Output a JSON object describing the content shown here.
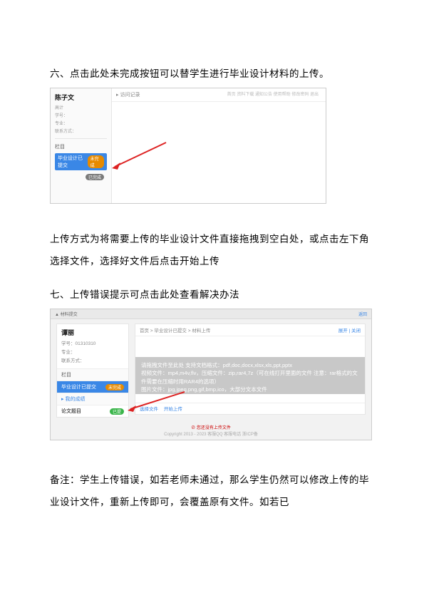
{
  "headings": {
    "six": "六、点击此处未完成按钮可以替学生进行毕业设计材料的上传。",
    "upload_note": "上传方式为将需要上传的毕业设计文件直接拖拽到空白处，或点击左下角选择文件，选择好文件后点击开始上传",
    "seven": "七、上传错误提示可点击此处查看解决办法",
    "remark": "备注：学生上传错误，如若老师未通过，那么学生仍然可以修改上传的毕业设计文件，重新上传即可，会覆盖原有文件。如若已"
  },
  "shot1": {
    "student_name": "陈子文",
    "sub1": "高计",
    "sub2": "学号：",
    "sub3": "专业：",
    "sub4": "联系方式：",
    "sec_label": "栏目",
    "row_active": "毕业设计已提交",
    "pill_active": "未完成",
    "row_plain_pill": "已完成",
    "crumb": "▸ 访问记录",
    "topbar": "首页  资料下载  通知公告  使用帮助  修改密码  退出"
  },
  "shot2": {
    "topnav_left": "▲ 材料提交",
    "topnav_right_ret": "返回",
    "student_name": "谭丽",
    "sub1": "学号：01310310",
    "sub2": "专业：",
    "sub3": "联系方式：",
    "cap1": "栏目",
    "row_blue": "毕业设计已提交",
    "row_blue_pill": "未完成",
    "cap_link": "▸ 我的成绩",
    "row_g": "论文题目",
    "row_g_pill": "已提",
    "ptop_left": "首页 > 毕业设计已提交 > 材料上传",
    "ptop_right": "展开 | 关闭",
    "drop_l1": "请拖拽文件至此处 支持文档格式：pdf,doc,docx,xlsx,xls,ppt,pptx",
    "drop_l2": "视频文件：mp4,m4v,flv，压缩文件：zip,rar4,7z（可在线打开里面的文件 注意：rar格式的文件需要在压缩时用RAR4的选项）",
    "drop_l3": "图片文件：jpg,jpeg,png,gif,bmp,ico，大部分文本文件",
    "foot_select": "选择文件",
    "foot_upload": "开始上传",
    "copy_warn": "⊘ 您还没有上传文件",
    "copy_text": "Copyright 2013 - 2023  客服QQ 客服电话 浙ICP备"
  }
}
